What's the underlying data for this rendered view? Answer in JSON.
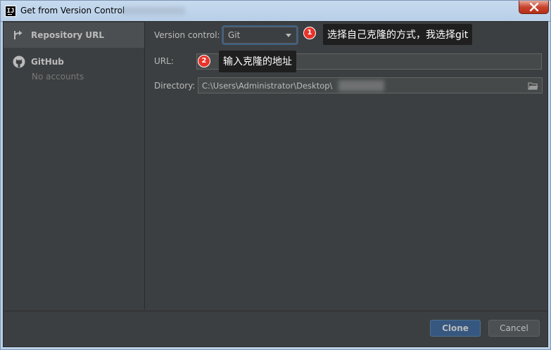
{
  "window": {
    "title": "Get from Version Control",
    "icon_letters": "IJ"
  },
  "sidebar": {
    "items": [
      {
        "label": "Repository URL",
        "icon": "vcs-arrow-icon",
        "selected": true
      },
      {
        "label": "GitHub",
        "icon": "github-icon",
        "sub": "No accounts"
      }
    ]
  },
  "form": {
    "version_control_label": "Version control:",
    "version_control_value": "Git",
    "url_label": "URL:",
    "url_value": "",
    "directory_label": "Directory:",
    "directory_value": "C:\\Users\\Administrator\\Desktop\\"
  },
  "annotations": [
    {
      "number": "1",
      "text": "选择自己克隆的方式，我选择git"
    },
    {
      "number": "2",
      "text": "输入克隆的地址"
    }
  ],
  "buttons": {
    "clone": "Clone",
    "cancel": "Cancel"
  },
  "colors": {
    "background": "#3c3f41",
    "selected_item": "#4b4f52",
    "primary_button": "#365880",
    "badge": "#e8332a"
  }
}
